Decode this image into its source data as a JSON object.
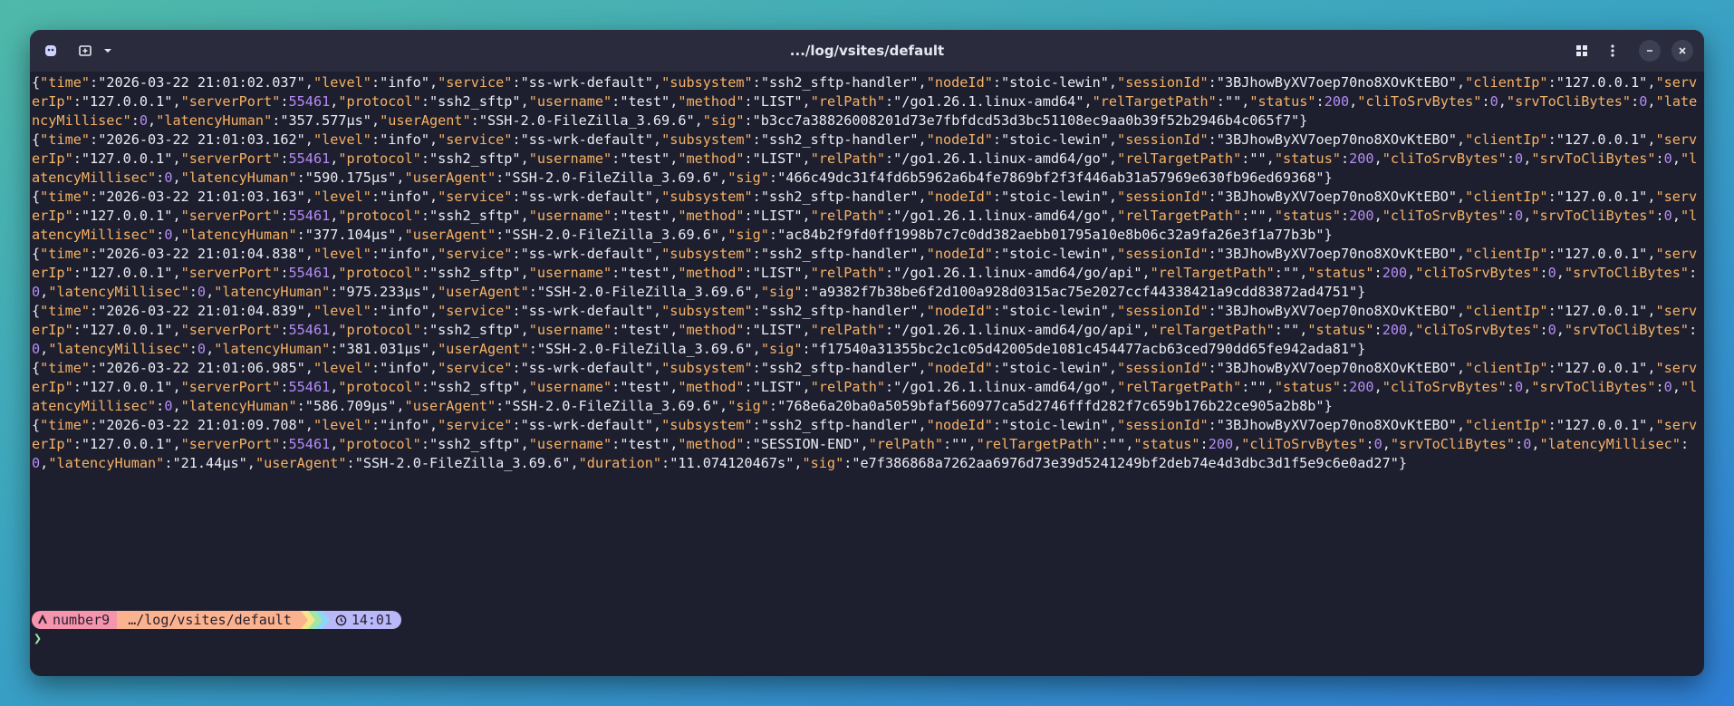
{
  "window": {
    "title": ".../log/vsites/default",
    "icons": [
      "app-icon",
      "new-tab-icon",
      "chevron-down-icon",
      "grid-icon",
      "kebab-menu-icon",
      "minimize-icon",
      "close-icon"
    ]
  },
  "colors": {
    "background": "#1e1f2e",
    "key": "#f5b267",
    "number": "#b58cf7",
    "prompt_user": "#f595ad",
    "prompt_path": "#fbb38f",
    "prompt_time": "#b9b8f8"
  },
  "log": [
    {
      "time": "2026-03-22 21:01:02.037",
      "level": "info",
      "service": "ss-wrk-default",
      "subsystem": "ssh2_sftp-handler",
      "nodeId": "stoic-lewin",
      "sessionId": "3BJhowByXV7oep70no8XOvKtEBO",
      "clientIp": "127.0.0.1",
      "serverIp": "127.0.0.1",
      "serverPort": 55461,
      "protocol": "ssh2_sftp",
      "username": "test",
      "method": "LIST",
      "relPath": "/go1.26.1.linux-amd64",
      "relTargetPath": "",
      "status": 200,
      "cliToSrvBytes": 0,
      "srvToCliBytes": 0,
      "latencyMillisec": 0,
      "latencyHuman": "357.577µs",
      "userAgent": "SSH-2.0-FileZilla_3.69.6",
      "sig": "b3cc7a38826008201d73e7fbfdcd53d3bc51108ec9aa0b39f52b2946b4c065f7"
    },
    {
      "time": "2026-03-22 21:01:03.162",
      "level": "info",
      "service": "ss-wrk-default",
      "subsystem": "ssh2_sftp-handler",
      "nodeId": "stoic-lewin",
      "sessionId": "3BJhowByXV7oep70no8XOvKtEBO",
      "clientIp": "127.0.0.1",
      "serverIp": "127.0.0.1",
      "serverPort": 55461,
      "protocol": "ssh2_sftp",
      "username": "test",
      "method": "LIST",
      "relPath": "/go1.26.1.linux-amd64/go",
      "relTargetPath": "",
      "status": 200,
      "cliToSrvBytes": 0,
      "srvToCliBytes": 0,
      "latencyMillisec": 0,
      "latencyHuman": "590.175µs",
      "userAgent": "SSH-2.0-FileZilla_3.69.6",
      "sig": "466c49dc31f4fd6b5962a6b4fe7869bf2f3f446ab31a57969e630fb96ed69368"
    },
    {
      "time": "2026-03-22 21:01:03.163",
      "level": "info",
      "service": "ss-wrk-default",
      "subsystem": "ssh2_sftp-handler",
      "nodeId": "stoic-lewin",
      "sessionId": "3BJhowByXV7oep70no8XOvKtEBO",
      "clientIp": "127.0.0.1",
      "serverIp": "127.0.0.1",
      "serverPort": 55461,
      "protocol": "ssh2_sftp",
      "username": "test",
      "method": "LIST",
      "relPath": "/go1.26.1.linux-amd64/go",
      "relTargetPath": "",
      "status": 200,
      "cliToSrvBytes": 0,
      "srvToCliBytes": 0,
      "latencyMillisec": 0,
      "latencyHuman": "377.104µs",
      "userAgent": "SSH-2.0-FileZilla_3.69.6",
      "sig": "ac84b2f9fd0ff1998b7c7c0dd382aebb01795a10e8b06c32a9fa26e3f1a77b3b"
    },
    {
      "time": "2026-03-22 21:01:04.838",
      "level": "info",
      "service": "ss-wrk-default",
      "subsystem": "ssh2_sftp-handler",
      "nodeId": "stoic-lewin",
      "sessionId": "3BJhowByXV7oep70no8XOvKtEBO",
      "clientIp": "127.0.0.1",
      "serverIp": "127.0.0.1",
      "serverPort": 55461,
      "protocol": "ssh2_sftp",
      "username": "test",
      "method": "LIST",
      "relPath": "/go1.26.1.linux-amd64/go/api",
      "relTargetPath": "",
      "status": 200,
      "cliToSrvBytes": 0,
      "srvToCliBytes": 0,
      "latencyMillisec": 0,
      "latencyHuman": "975.233µs",
      "userAgent": "SSH-2.0-FileZilla_3.69.6",
      "sig": "a9382f7b38be6f2d100a928d0315ac75e2027ccf44338421a9cdd83872ad4751"
    },
    {
      "time": "2026-03-22 21:01:04.839",
      "level": "info",
      "service": "ss-wrk-default",
      "subsystem": "ssh2_sftp-handler",
      "nodeId": "stoic-lewin",
      "sessionId": "3BJhowByXV7oep70no8XOvKtEBO",
      "clientIp": "127.0.0.1",
      "serverIp": "127.0.0.1",
      "serverPort": 55461,
      "protocol": "ssh2_sftp",
      "username": "test",
      "method": "LIST",
      "relPath": "/go1.26.1.linux-amd64/go/api",
      "relTargetPath": "",
      "status": 200,
      "cliToSrvBytes": 0,
      "srvToCliBytes": 0,
      "latencyMillisec": 0,
      "latencyHuman": "381.031µs",
      "userAgent": "SSH-2.0-FileZilla_3.69.6",
      "sig": "f17540a31355bc2c1c05d42005de1081c454477acb63ced790dd65fe942ada81"
    },
    {
      "time": "2026-03-22 21:01:06.985",
      "level": "info",
      "service": "ss-wrk-default",
      "subsystem": "ssh2_sftp-handler",
      "nodeId": "stoic-lewin",
      "sessionId": "3BJhowByXV7oep70no8XOvKtEBO",
      "clientIp": "127.0.0.1",
      "serverIp": "127.0.0.1",
      "serverPort": 55461,
      "protocol": "ssh2_sftp",
      "username": "test",
      "method": "LIST",
      "relPath": "/go1.26.1.linux-amd64/go",
      "relTargetPath": "",
      "status": 200,
      "cliToSrvBytes": 0,
      "srvToCliBytes": 0,
      "latencyMillisec": 0,
      "latencyHuman": "586.709µs",
      "userAgent": "SSH-2.0-FileZilla_3.69.6",
      "sig": "768e6a20ba0a5059bfaf560977ca5d2746fffd282f7c659b176b22ce905a2b8b"
    },
    {
      "time": "2026-03-22 21:01:09.708",
      "level": "info",
      "service": "ss-wrk-default",
      "subsystem": "ssh2_sftp-handler",
      "nodeId": "stoic-lewin",
      "sessionId": "3BJhowByXV7oep70no8XOvKtEBO",
      "clientIp": "127.0.0.1",
      "serverIp": "127.0.0.1",
      "serverPort": 55461,
      "protocol": "ssh2_sftp",
      "username": "test",
      "method": "SESSION-END",
      "relPath": "",
      "relTargetPath": "",
      "status": 200,
      "cliToSrvBytes": 0,
      "srvToCliBytes": 0,
      "latencyMillisec": 0,
      "latencyHuman": "21.44µs",
      "userAgent": "SSH-2.0-FileZilla_3.69.6",
      "duration": "11.074120467s",
      "sig": "e7f386868a7262aa6976d73e39d5241249bf2deb74e4d3dbc3d1f5e9c6e0ad27"
    }
  ],
  "prompt": {
    "user": "number9",
    "path": "…/log/vsites/default",
    "time": "14:01",
    "cursor": "❯"
  }
}
